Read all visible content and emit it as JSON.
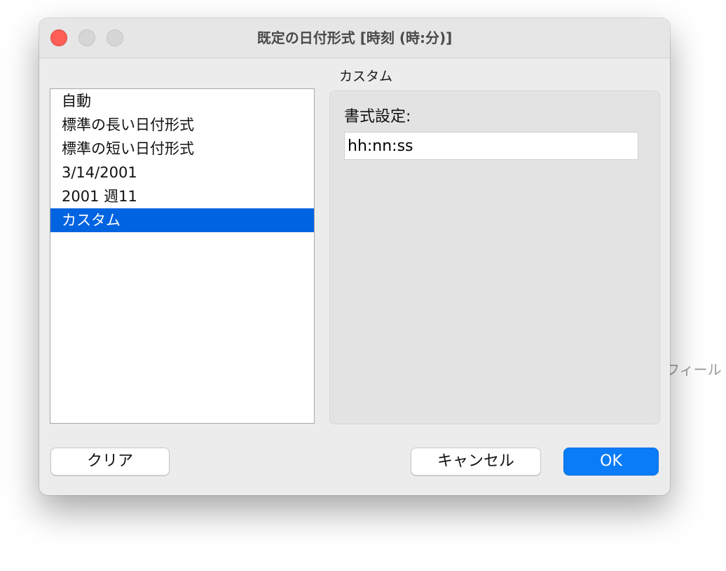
{
  "window": {
    "title": "既定の日付形式 [時刻 (時:分)]"
  },
  "background": {
    "partial_text": "フィール"
  },
  "section_label": "カスタム",
  "format_list": {
    "items": [
      {
        "label": "自動",
        "selected": false
      },
      {
        "label": "標準の長い日付形式",
        "selected": false
      },
      {
        "label": "標準の短い日付形式",
        "selected": false
      },
      {
        "label": "3/14/2001",
        "selected": false
      },
      {
        "label": "2001 週11",
        "selected": false
      },
      {
        "label": "カスタム",
        "selected": true
      }
    ]
  },
  "settings": {
    "format_label": "書式設定:",
    "format_value": "hh:nn:ss"
  },
  "buttons": {
    "clear": "クリア",
    "cancel": "キャンセル",
    "ok": "OK"
  },
  "colors": {
    "selection": "#0064e1",
    "primary_button": "#0a7cf7",
    "close_button": "#ff5f57"
  }
}
